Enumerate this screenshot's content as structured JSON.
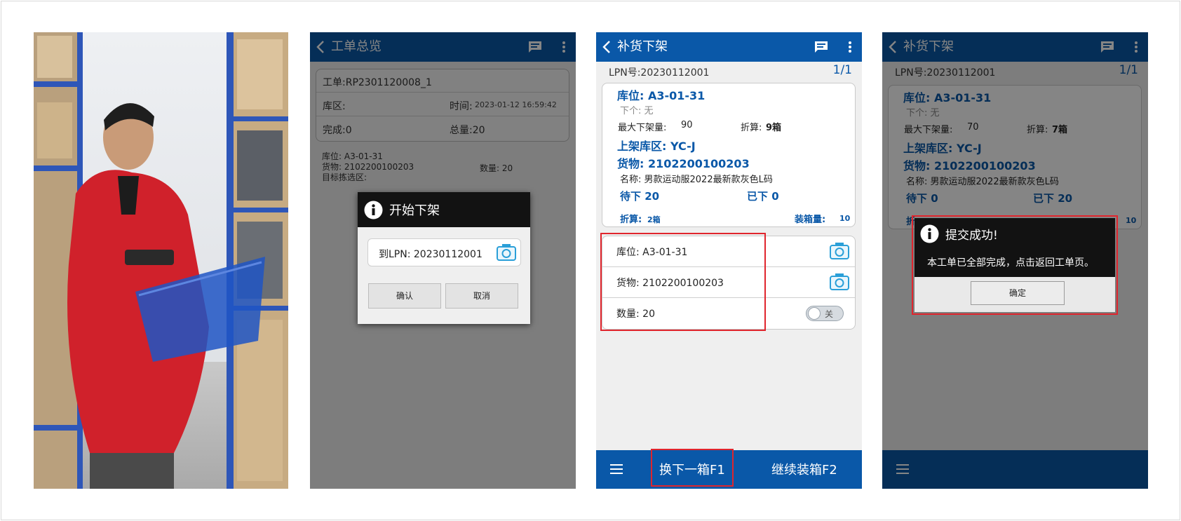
{
  "panel2": {
    "appbar": {
      "title": "工单总览"
    },
    "summary": {
      "order": "工单:RP2301120008_1",
      "zone_label": "库区:",
      "time_label": "时间:",
      "time_value": "2023-01-12 16:59:42",
      "done": "完成:0",
      "total": "总量:20"
    },
    "info": {
      "location": "库位: A3-01-31",
      "goods": "货物: 2102200100203",
      "qty": "数量: 20",
      "target": "目标拣选区:"
    },
    "dialog": {
      "title": "开始下架",
      "lpn_value": "到LPN: 20230112001",
      "confirm": "确认",
      "cancel": "取消"
    }
  },
  "panel3": {
    "appbar": {
      "title": "补货下架"
    },
    "lpn": "LPN号:20230112001",
    "page": "1/1",
    "card": {
      "location": "库位: A3-01-31",
      "next": "下个: 无",
      "max_label": "最大下架量:",
      "max_value": "90",
      "convert_label": "折算:",
      "convert_value": "9箱",
      "putaway_zone": "上架库区: YC-J",
      "goods": "货物: 2102200100203",
      "name": "名称: 男款运动服2022最新款灰色L码",
      "pending": "待下 20",
      "done": "已下 0",
      "convert2_label": "折算:",
      "convert2_value": "2箱",
      "box_qty_label": "装箱量:",
      "box_qty_value": "10"
    },
    "scan": {
      "location": "库位: A3-01-31",
      "goods": "货物: 2102200100203",
      "qty": "数量: 20",
      "toggle": "关"
    },
    "bottom": {
      "next_box": "换下一箱F1",
      "continue": "继续装箱F2"
    }
  },
  "panel4": {
    "appbar": {
      "title": "补货下架"
    },
    "lpn": "LPN号:20230112001",
    "page": "1/1",
    "card": {
      "location": "库位: A3-01-31",
      "next": "下个: 无",
      "max_label": "最大下架量:",
      "max_value": "70",
      "convert_label": "折算:",
      "convert_value": "7箱",
      "putaway_zone": "上架库区: YC-J",
      "goods": "货物: 2102200100203",
      "name": "名称: 男款运动服2022最新款灰色L码",
      "pending": "待下 0",
      "done": "已下 20",
      "convert2_label": "折",
      "box_qty_value": "10"
    },
    "dialog": {
      "title": "提交成功!",
      "message": "本工单已全部完成，点击返回工单页。",
      "ok": "确定"
    }
  },
  "colors": {
    "primary": "#0a58a8",
    "highlight": "#e0252d",
    "dialog": "#121212"
  }
}
